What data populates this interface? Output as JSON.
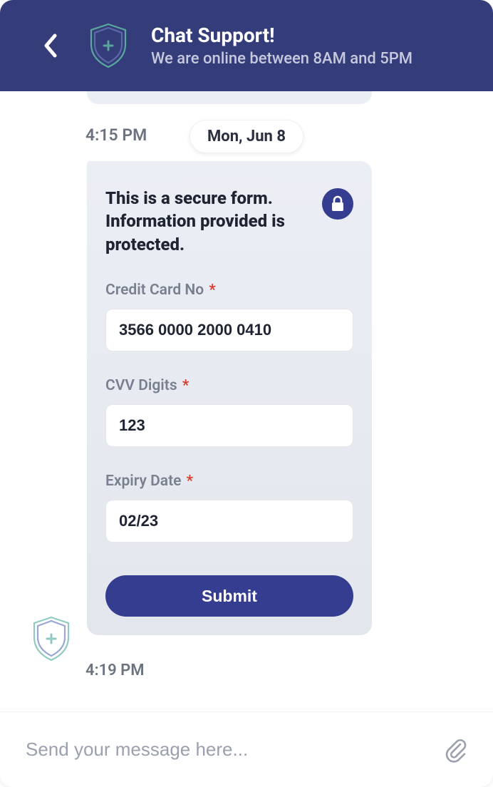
{
  "header": {
    "title": "Chat Support!",
    "subtitle": "We are online between 8AM and 5PM"
  },
  "timeline": {
    "prev_message_time": "4:15 PM",
    "date_chip": "Mon, Jun 8",
    "form_time": "4:19 PM"
  },
  "secure_form": {
    "heading": "This is a secure form. Information provided is protected.",
    "fields": {
      "card": {
        "label": "Credit Card No",
        "required_mark": "*",
        "value": "3566 0000 2000 0410"
      },
      "cvv": {
        "label": "CVV Digits",
        "required_mark": "*",
        "value": "123"
      },
      "exp": {
        "label": "Expiry Date",
        "required_mark": "*",
        "value": "02/23"
      }
    },
    "submit_label": "Submit"
  },
  "composer": {
    "placeholder": "Send your message here..."
  },
  "icons": {
    "back": "chevron-left",
    "shield_plus": "shield-plus",
    "lock": "lock",
    "attach": "paperclip"
  }
}
